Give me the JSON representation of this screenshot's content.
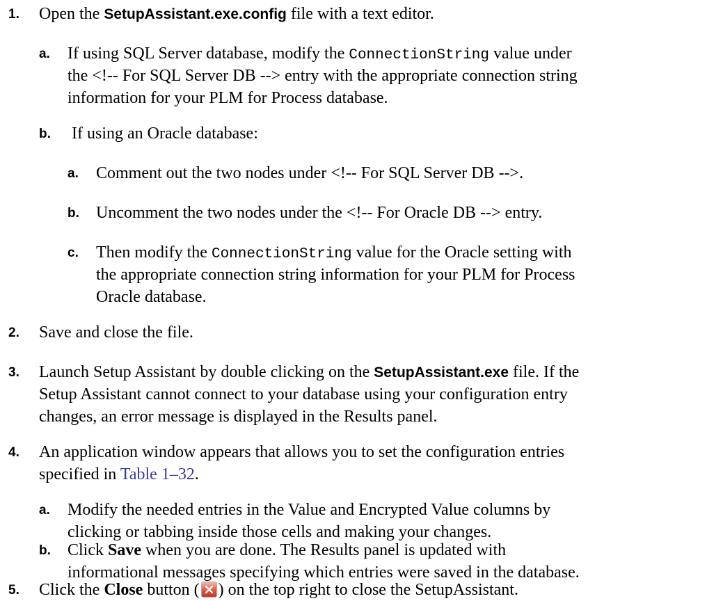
{
  "steps": [
    {
      "num": "1.",
      "line1": {
        "t1": "Open the ",
        "b1": "SetupAssistant.exe.config",
        "t2": " file with a text editor."
      },
      "subs": [
        {
          "num": "a.",
          "l1": {
            "t1": "If using SQL Server database, modify the ",
            "c1": "ConnectionString",
            "t2": " value under"
          },
          "l2": "the <!-- For SQL Server DB --> entry with the appropriate connection string",
          "l3": "information for your PLM for Process database."
        },
        {
          "num": "b.",
          "l1": " If using an Oracle database:",
          "subs": [
            {
              "num": "a.",
              "l1": "Comment out the two nodes under <!-- For SQL Server DB -->."
            },
            {
              "num": "b.",
              "l1": "Uncomment the two nodes under the <!-- For Oracle DB --> entry."
            },
            {
              "num": "c.",
              "l1": {
                "t1": "Then modify the ",
                "c1": "ConnectionString",
                "t2": " value for the Oracle setting with"
              },
              "l2": "the appropriate connection string information for your PLM for Process",
              "l3": "Oracle database."
            }
          ]
        }
      ]
    },
    {
      "num": "2.",
      "line1": "Save and close the file."
    },
    {
      "num": "3.",
      "line1": {
        "t1": "Launch Setup Assistant by double clicking on the ",
        "b1": "SetupAssistant.exe",
        "t2": " file. If the"
      },
      "line2": "Setup Assistant cannot connect to your database using your configuration entry",
      "line3": "changes, an error message is displayed in the Results panel."
    },
    {
      "num": "4.",
      "line1": "An application window appears that allows you to set the configuration entries",
      "line2": {
        "t1": "specified in ",
        "link": "Table 1–32",
        "t2": "."
      },
      "subs": [
        {
          "num": "a.",
          "l1": "Modify the needed entries in the Value and Encrypted Value columns by",
          "l2": "clicking or tabbing inside those cells and making your changes."
        },
        {
          "num": "b.",
          "l1": {
            "t1": "Click ",
            "b1": "Save",
            "t2": " when you are done. The Results panel is updated with"
          },
          "l2": "informational messages specifying which entries were saved in the database."
        }
      ]
    },
    {
      "num": "5.",
      "line1": {
        "t1": "Click the ",
        "b1": "Close",
        "t2": " button (",
        "t3": ") on the top right to close the SetupAssistant."
      },
      "icon": "close-icon",
      "icon_color": "#e8533a"
    }
  ]
}
